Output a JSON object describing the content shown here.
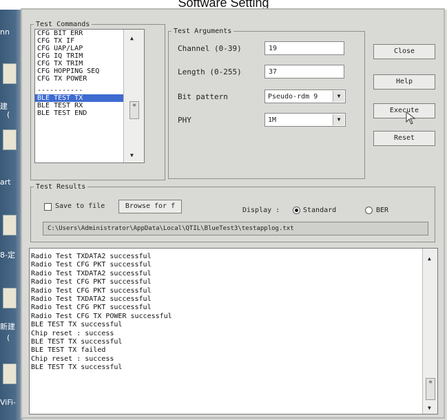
{
  "window_title": "Software Setting",
  "desktop": {
    "side_labels": [
      "nn",
      "建",
      "(",
      "art",
      "8-定",
      "新建",
      "(",
      "ViFi-"
    ]
  },
  "test_commands": {
    "legend": "Test Commands",
    "items": [
      "CFG BIT ERR",
      "CFG TX IF",
      "CFG UAP/LAP",
      "CFG IQ TRIM",
      "CFG TX TRIM",
      "CFG HOPPING SEQ",
      "CFG TX POWER",
      "-----------",
      "BLE TEST TX",
      "BLE TEST RX",
      "BLE TEST END"
    ],
    "selected_index": 8
  },
  "test_arguments": {
    "legend": "Test Arguments",
    "channel_label": "Channel (0-39)",
    "channel_value": "19",
    "length_label": "Length (0-255)",
    "length_value": "37",
    "bit_pattern_label": "Bit pattern",
    "bit_pattern_value": "Pseudo-rdm 9",
    "phy_label": "PHY",
    "phy_value": "1M"
  },
  "buttons": {
    "close": "Close",
    "help": "Help",
    "execute": "Execute",
    "reset": "Reset",
    "browse": "Browse for f"
  },
  "test_results": {
    "legend": "Test Results",
    "save_to_file_label": "Save to file",
    "save_to_file_checked": false,
    "display_label": "Display :",
    "standard_label": "Standard",
    "ber_label": "BER",
    "display_mode": "Standard",
    "log_path": "C:\\Users\\Administrator\\AppData\\Local\\QTIL\\BlueTest3\\testapplog.txt"
  },
  "log_lines": [
    "Radio Test TXDATA2 successful",
    "Radio Test CFG PKT successful",
    "Radio Test TXDATA2 successful",
    "Radio Test CFG PKT successful",
    "Radio Test CFG PKT successful",
    "Radio Test TXDATA2 successful",
    "Radio Test CFG PKT successful",
    "Radio Test CFG TX POWER successful",
    "BLE TEST TX successful",
    "Chip reset : success",
    "BLE TEST TX successful",
    "BLE TEST TX failed",
    "Chip reset : success",
    "BLE TEST TX successful"
  ],
  "icons": {
    "scroll_up": "up-arrow-icon",
    "scroll_down": "down-arrow-icon",
    "dropdown": "chevron-down-icon",
    "cursor": "mouse-pointer-icon"
  }
}
